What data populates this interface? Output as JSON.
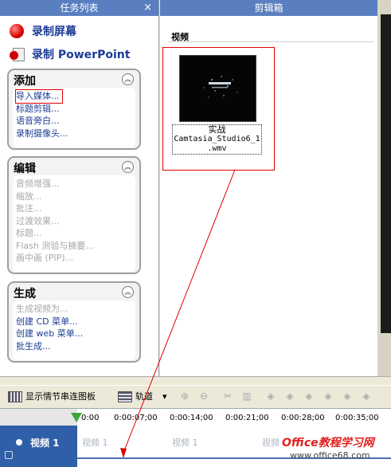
{
  "task_pane": {
    "title": "任务列表",
    "close": "×",
    "record_screen": "录制屏幕",
    "record_ppt": "录制 PowerPoint",
    "groups": [
      {
        "title": "添加",
        "items": [
          {
            "label": "导入媒体...",
            "enabled": true
          },
          {
            "label": "标题剪辑...",
            "enabled": true
          },
          {
            "label": "语音旁白...",
            "enabled": true
          },
          {
            "label": "录制摄像头...",
            "enabled": true
          }
        ]
      },
      {
        "title": "编辑",
        "items": [
          {
            "label": "音频增强...",
            "enabled": false
          },
          {
            "label": "缩放...",
            "enabled": false
          },
          {
            "label": "批注...",
            "enabled": false
          },
          {
            "label": "过渡效果...",
            "enabled": false
          },
          {
            "label": "标题...",
            "enabled": false
          },
          {
            "label": "Flash 测验与摘要...",
            "enabled": false
          },
          {
            "label": "画中画 (PIP)...",
            "enabled": false
          }
        ]
      },
      {
        "title": "生成",
        "items": [
          {
            "label": "生成视频为...",
            "enabled": false
          },
          {
            "label": "创建 CD 菜单...",
            "enabled": true
          },
          {
            "label": "创建 web 菜单...",
            "enabled": true
          },
          {
            "label": "批生成...",
            "enabled": true
          }
        ]
      }
    ]
  },
  "clip_bin": {
    "title": "剪辑箱",
    "section": "视频",
    "clip": {
      "line1": "实战",
      "line2": "Camtasia_Studio6_1",
      "line3": ".wmv"
    }
  },
  "toolbar": {
    "storyboard_label": "显示情节串连图板",
    "tracks_label": "轨道",
    "tracks_arrow": "▾"
  },
  "timeline": {
    "ticks": [
      "0:00",
      "0:00:07;00",
      "0:00:14;00",
      "0:00:21;00",
      "0:00:28;00",
      "0:00:35;00"
    ],
    "track_name": "视频 1",
    "lane_labels": [
      "视频 1",
      "视频 1",
      "视频"
    ]
  },
  "watermark": {
    "line1": "Office教程学习网",
    "line2": "www.office68.com"
  },
  "colors": {
    "accent_red": "#e00000",
    "title_blue": "#5a7fc0",
    "link_blue": "#1c3d96",
    "track_blue": "#2f5fa8"
  }
}
